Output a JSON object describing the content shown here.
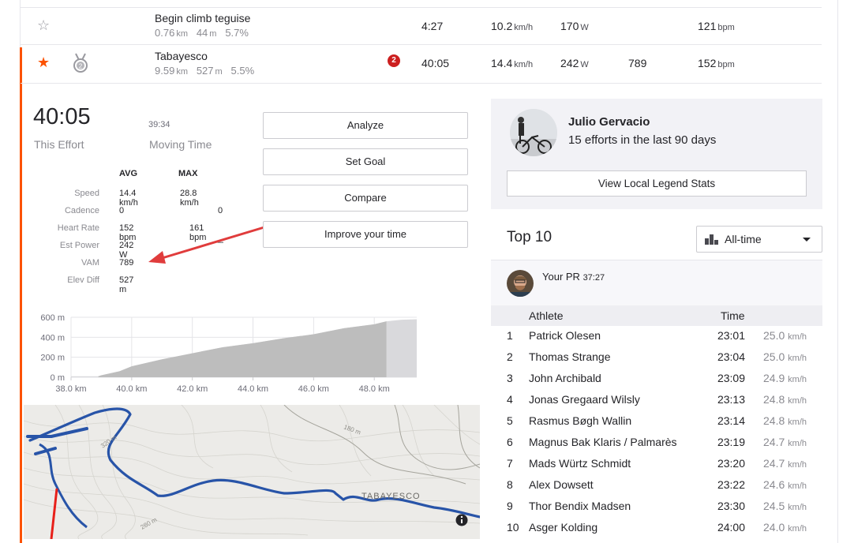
{
  "segments": [
    {
      "starred": false,
      "name": "Begin climb teguise",
      "distance": "0.76",
      "distance_unit": "km",
      "elev": "44",
      "elev_unit": "m",
      "grade": "5.7%",
      "badge": "",
      "time": "4:27",
      "speed": "10.2",
      "speed_unit": "km/h",
      "power": "170",
      "power_unit": "W",
      "vam": "",
      "hr": "121",
      "hr_unit": "bpm"
    },
    {
      "starred": true,
      "name": "Tabayesco",
      "distance": "9.59",
      "distance_unit": "km",
      "elev": "527",
      "elev_unit": "m",
      "grade": "5.5%",
      "badge": "2",
      "time": "40:05",
      "speed": "14.4",
      "speed_unit": "km/h",
      "power": "242",
      "power_unit": "W",
      "vam": "789",
      "hr": "152",
      "hr_unit": "bpm"
    }
  ],
  "icons": {
    "star_empty": "star-outline-icon",
    "star_filled": "star-filled-icon",
    "medal": "medal-icon",
    "badge": "achievement-badge-icon",
    "dropdown_bars": "bar-chart-icon",
    "caret": "caret-down-icon",
    "info": "info-icon"
  },
  "colors": {
    "accent": "#fc5200",
    "badge": "#cc1f1f",
    "route": "#2854a8",
    "route_alt": "#e8201a",
    "arrow": "#e03c3c",
    "elevation": "#bdbdbd"
  },
  "effort": {
    "time": "40:05",
    "time_label": "This Effort",
    "moving_time": "39:34",
    "moving_label": "Moving Time",
    "stats_headers": {
      "avg": "AVG",
      "max": "MAX"
    },
    "stats": [
      {
        "label": "Speed",
        "avg": "14.4 km/h",
        "max": "28.8 km/h"
      },
      {
        "label": "Cadence",
        "avg": "0",
        "max": "0"
      },
      {
        "label": "Heart Rate",
        "avg": "152 bpm",
        "max": "161 bpm"
      },
      {
        "label": "Est Power",
        "avg": "242 W",
        "max": "—"
      },
      {
        "label": "VAM",
        "avg": "789",
        "max": ""
      },
      {
        "label": "Elev Diff",
        "avg": "527 m",
        "max": ""
      }
    ]
  },
  "actions": {
    "analyze": "Analyze",
    "set_goal": "Set Goal",
    "compare": "Compare",
    "improve": "Improve your time"
  },
  "local_legend": {
    "name": "Julio Gervacio",
    "efforts": "15 efforts in the last 90 days",
    "button": "View Local Legend Stats"
  },
  "top10": {
    "title": "Top 10",
    "filter": "All-time",
    "pr_label": "Your PR",
    "pr_time": "37:27",
    "col_athlete": "Athlete",
    "col_time": "Time",
    "rows": [
      {
        "rank": "1",
        "name": "Patrick Olesen",
        "time": "23:01",
        "speed": "25.0",
        "unit": "km/h"
      },
      {
        "rank": "2",
        "name": "Thomas Strange",
        "time": "23:04",
        "speed": "25.0",
        "unit": "km/h"
      },
      {
        "rank": "3",
        "name": "John Archibald",
        "time": "23:09",
        "speed": "24.9",
        "unit": "km/h"
      },
      {
        "rank": "4",
        "name": "Jonas Gregaard Wilsly",
        "time": "23:13",
        "speed": "24.8",
        "unit": "km/h"
      },
      {
        "rank": "5",
        "name": "Rasmus Bøgh Wallin",
        "time": "23:14",
        "speed": "24.8",
        "unit": "km/h"
      },
      {
        "rank": "6",
        "name": "Magnus Bak Klaris / Palmarès",
        "time": "23:19",
        "speed": "24.7",
        "unit": "km/h"
      },
      {
        "rank": "7",
        "name": "Mads Würtz Schmidt",
        "time": "23:20",
        "speed": "24.7",
        "unit": "km/h"
      },
      {
        "rank": "8",
        "name": "Alex Dowsett",
        "time": "23:22",
        "speed": "24.6",
        "unit": "km/h"
      },
      {
        "rank": "9",
        "name": "Thor Bendix Madsen",
        "time": "23:30",
        "speed": "24.5",
        "unit": "km/h"
      },
      {
        "rank": "10",
        "name": "Asger Kolding",
        "time": "24:00",
        "speed": "24.0",
        "unit": "km/h"
      }
    ]
  },
  "chart_data": {
    "type": "area",
    "x": [
      38.0,
      38.9,
      39.0,
      39.6,
      40.0,
      41.0,
      42.0,
      43.0,
      44.0,
      45.0,
      46.0,
      47.0,
      48.0,
      48.4,
      48.9,
      49.4
    ],
    "y": [
      10,
      10,
      20,
      60,
      110,
      180,
      240,
      300,
      340,
      390,
      430,
      490,
      530,
      560,
      575,
      580
    ],
    "segment_range": [
      38.9,
      48.4
    ],
    "ylim": [
      0,
      600
    ],
    "xlim": [
      38.0,
      49.4
    ],
    "yticks": [
      "0 m",
      "200 m",
      "400 m",
      "600 m"
    ],
    "xticks": [
      "38.0 km",
      "40.0 km",
      "42.0 km",
      "44.0 km",
      "46.0 km",
      "48.0 km"
    ],
    "grid": true
  },
  "map": {
    "labels": {
      "place": "TABAYESCO",
      "c320": "320 m",
      "c180": "180 m",
      "c280": "280 m"
    }
  }
}
